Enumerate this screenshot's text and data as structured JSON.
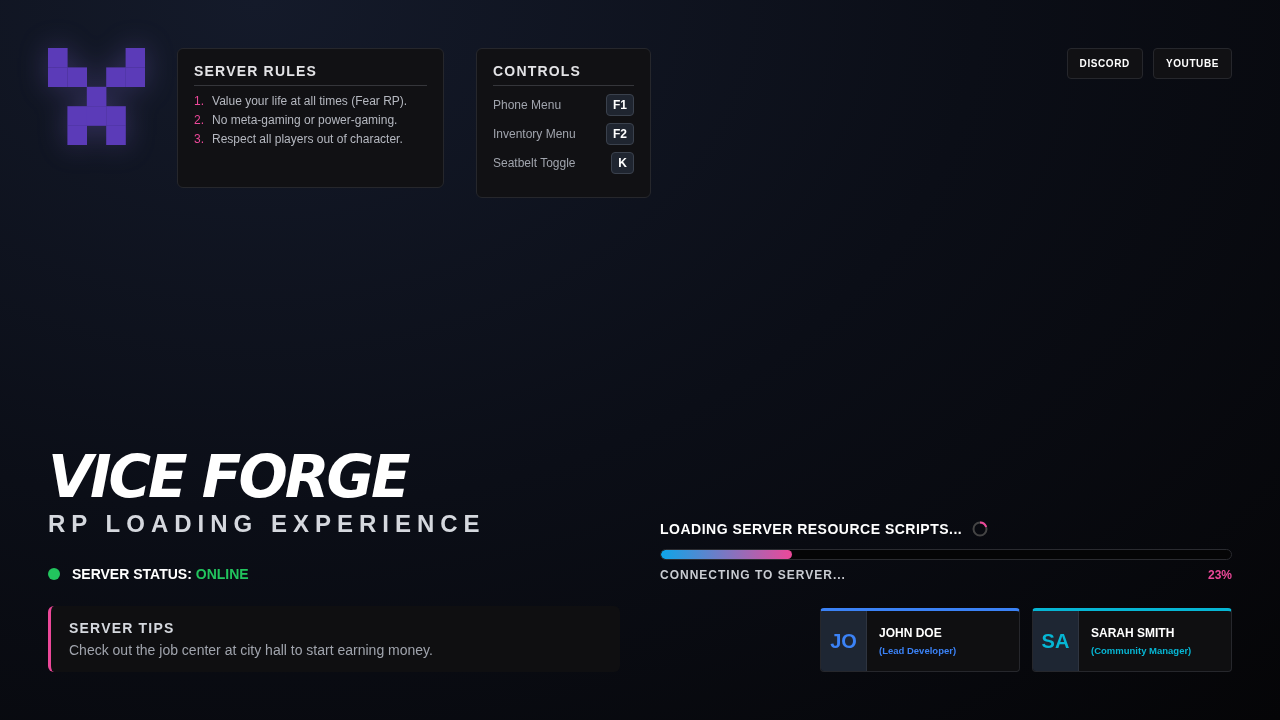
{
  "rules": {
    "title": "SERVER RULES",
    "items": [
      {
        "number": "1.",
        "text": "Value your life at all times (Fear RP)."
      },
      {
        "number": "2.",
        "text": "No meta-gaming or power-gaming."
      },
      {
        "number": "3.",
        "text": "Respect all players out of character."
      }
    ]
  },
  "controls": {
    "title": "CONTROLS",
    "items": [
      {
        "label": "Phone Menu",
        "key": "F1"
      },
      {
        "label": "Inventory Menu",
        "key": "F2"
      },
      {
        "label": "Seatbelt Toggle",
        "key": "K"
      }
    ]
  },
  "links": [
    "DISCORD",
    "YOUTUBE"
  ],
  "title": "VICE FORGE",
  "subtitle": "RP LOADING EXPERIENCE",
  "status": {
    "label": "SERVER STATUS:",
    "value": "ONLINE",
    "color": "#22c55e"
  },
  "tips": {
    "title": "SERVER TIPS",
    "text": "Check out the job center at city hall to start earning money."
  },
  "loading": {
    "message": "LOADING SERVER RESOURCE SCRIPTS...",
    "level": 0.23,
    "stage": "CONNECTING TO SERVER...",
    "percent": "23%"
  },
  "staff": [
    {
      "initials": "JO",
      "name": "JOHN DOE",
      "role": "(Lead Developer)",
      "color": "#3b82f6"
    },
    {
      "initials": "SA",
      "name": "SARAH SMITH",
      "role": "(Community Manager)",
      "color": "#06b6d4"
    }
  ]
}
